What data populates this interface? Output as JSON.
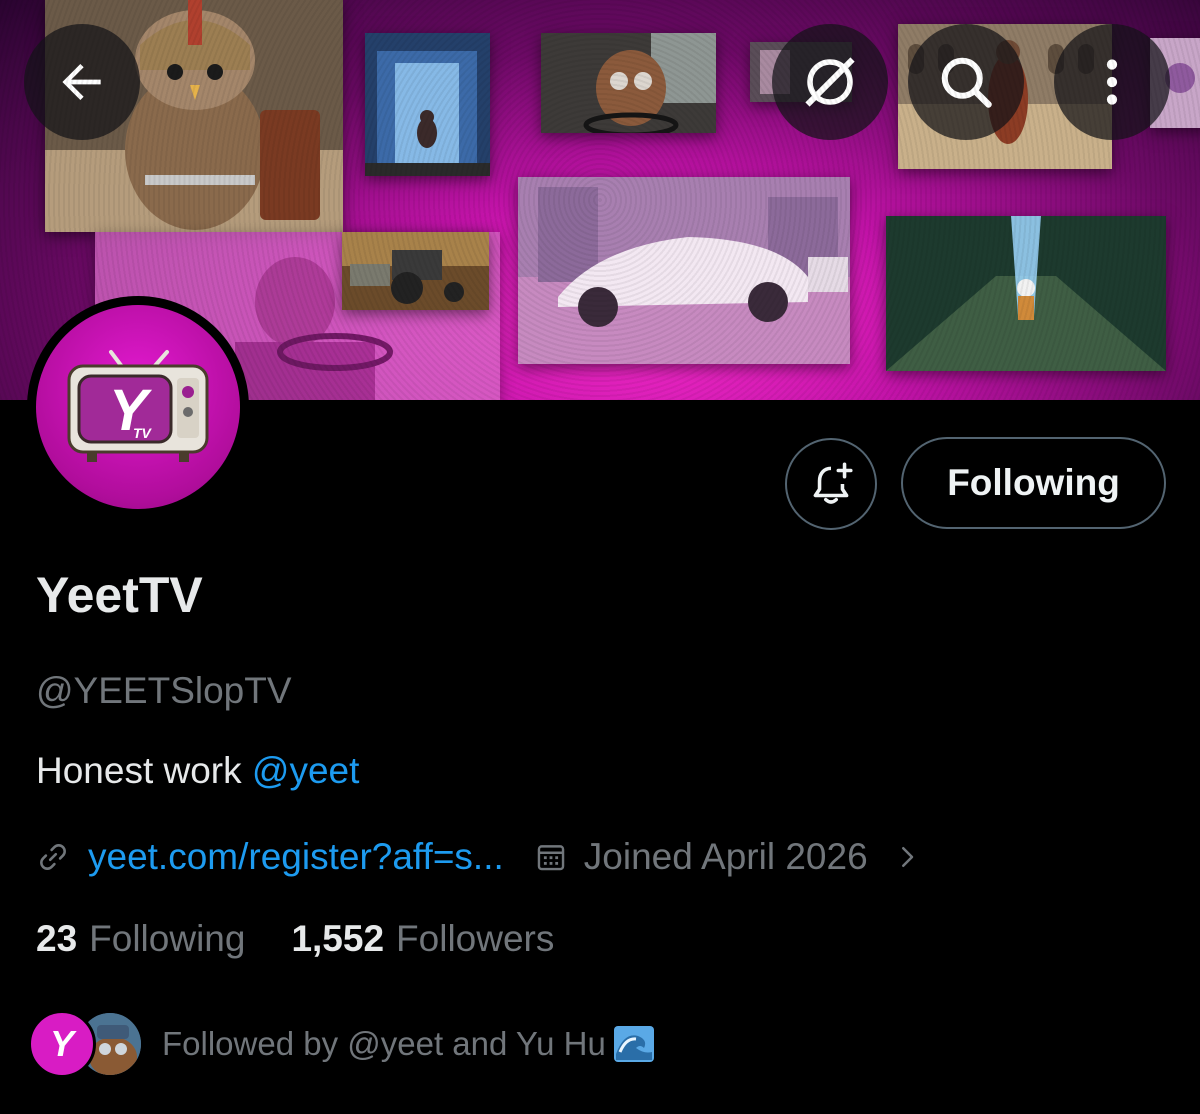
{
  "banner": {
    "back_icon": "arrow-left-icon",
    "grok_icon": "grok-icon",
    "search_icon": "search-icon",
    "more_icon": "more-vertical-icon"
  },
  "avatar": {
    "logo_text": "Y",
    "logo_sub": "TV"
  },
  "actions": {
    "notify_icon": "bell-plus-icon",
    "follow_label": "Following"
  },
  "profile": {
    "display_name": "YeetTV",
    "handle": "@YEETSlopTV",
    "bio_text": "Honest work ",
    "bio_mention": "@yeet",
    "link_text": "yeet.com/register?aff=s...",
    "joined_text": "Joined April 2026"
  },
  "stats": {
    "following_count": "23",
    "following_label": "Following",
    "followers_count": "1,552",
    "followers_label": "Followers"
  },
  "followed_by": {
    "avatar1_letter": "Y",
    "text": "Followed by @yeet and Yu Hu"
  },
  "colors": {
    "accent_link": "#1d9bf0",
    "muted": "#71767b",
    "brand_magenta": "#d81cc4"
  }
}
